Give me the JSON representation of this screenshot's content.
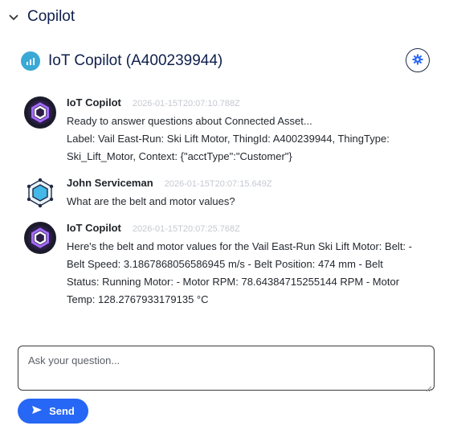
{
  "section": {
    "title": "Copilot",
    "icon": "chevron-down-icon"
  },
  "header": {
    "title": "IoT Copilot (A400239944)",
    "app_icon": "bar-chart-icon",
    "settings_icon": "gear-icon"
  },
  "messages": [
    {
      "author": "IoT Copilot",
      "timestamp": "2026-01-15T20:07:10.788Z",
      "avatar": "copilot-hexagon-icon",
      "lines": [
        "Ready to answer questions about Connected Asset...",
        "Label: Vail East-Run: Ski Lift Motor, ThingId: A400239944, ThingType:",
        "Ski_Lift_Motor, Context: {\"acctType\":\"Customer\"}"
      ]
    },
    {
      "author": "John Serviceman",
      "timestamp": "2026-01-15T20:07:15.649Z",
      "avatar": "user-hexagon-icon",
      "lines": [
        "What are the belt and motor values?"
      ]
    },
    {
      "author": "IoT Copilot",
      "timestamp": "2026-01-15T20:07:25.768Z",
      "avatar": "copilot-hexagon-icon",
      "lines": [
        "Here's the belt and motor values for the Vail East-Run Ski Lift Motor: Belt: -",
        "Belt Speed: 3.1867868056586945 m/s - Belt Position: 474 mm - Belt",
        "Status: Running Motor: - Motor RPM: 78.64384715255144 RPM - Motor",
        "Temp: 128.2767933179135 °C"
      ]
    }
  ],
  "input": {
    "placeholder": "Ask your question...",
    "value": ""
  },
  "send": {
    "label": "Send",
    "icon": "send-icon"
  },
  "colors": {
    "accent": "#2767f5",
    "title": "#0f1f4d",
    "app_icon_bg": "#3aa9d6"
  }
}
